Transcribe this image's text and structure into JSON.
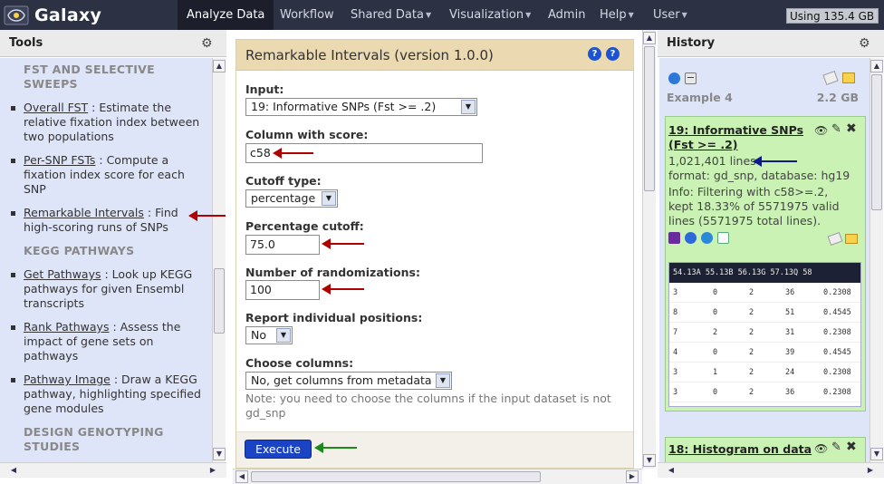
{
  "masthead": {
    "brand": "Galaxy",
    "tabs": [
      {
        "label": "Analyze Data",
        "active": true,
        "has_menu": false
      },
      {
        "label": "Workflow",
        "active": false,
        "has_menu": false
      },
      {
        "label": "Shared Data",
        "active": false,
        "has_menu": true
      },
      {
        "label": "Visualization",
        "active": false,
        "has_menu": true
      },
      {
        "label": "Admin",
        "active": false,
        "has_menu": false
      },
      {
        "label": "Help",
        "active": false,
        "has_menu": true
      },
      {
        "label": "User",
        "active": false,
        "has_menu": true
      }
    ],
    "usage": "Using 135.4 GB"
  },
  "tools": {
    "header": "Tools",
    "sections": [
      {
        "title": "FST AND SELECTIVE SWEEPS"
      },
      {
        "title": "KEGG PATHWAYS"
      },
      {
        "title": "DESIGN GENOTYPING STUDIES"
      }
    ],
    "items": [
      {
        "link": "Overall FST",
        "desc": " : Estimate the relative fixation index between two populations"
      },
      {
        "link": "Per-SNP FSTs",
        "desc": " : Compute a fixation index score for each SNP"
      },
      {
        "link": "Remarkable Intervals",
        "desc": " : Find high-scoring runs of SNPs"
      },
      {
        "link": "Get Pathways",
        "desc": " : Look up KEGG pathways for given Ensembl transcripts"
      },
      {
        "link": "Rank Pathways",
        "desc": " : Assess the impact of gene sets on pathways"
      },
      {
        "link": "Pathway Image",
        "desc": " : Draw a KEGG pathway, highlighting specified gene modules"
      }
    ]
  },
  "form": {
    "title": "Remarkable Intervals (version 1.0.0)",
    "input_label": "Input:",
    "input_value": "19: Informative SNPs (Fst >= .2)",
    "column_label": "Column with score:",
    "column_value": "c58",
    "cutoff_type_label": "Cutoff type:",
    "cutoff_type_value": "percentage",
    "pct_label": "Percentage cutoff:",
    "pct_value": "75.0",
    "rand_label": "Number of randomizations:",
    "rand_value": "100",
    "report_label": "Report individual positions:",
    "report_value": "No",
    "columns_label": "Choose columns:",
    "columns_value": "No, get columns from metadata",
    "note": "Note: you need to choose the columns if the input dataset is not gd_snp",
    "execute": "Execute"
  },
  "history": {
    "header": "History",
    "name": "Example 4",
    "size": "2.2 GB",
    "dataset19": {
      "title_line1": "19: Informative SNPs",
      "title_line2": "(Fst >= .2)",
      "lines": "1,021,401 lines",
      "format": "format: gd_snp, database: hg19",
      "info1": "Info: Filtering with c58>=.2,",
      "info2": "kept 18.33% of 5571975 valid",
      "info3": "lines (5571975 total lines).",
      "peek_header": "54.13A 55.13B 56.13G 57.13Q 58",
      "peek_rows": [
        [
          "3",
          "0",
          "2",
          "36",
          "0.2308"
        ],
        [
          "8",
          "0",
          "2",
          "51",
          "0.4545"
        ],
        [
          "7",
          "2",
          "2",
          "31",
          "0.2308"
        ],
        [
          "4",
          "0",
          "2",
          "39",
          "0.4545"
        ],
        [
          "3",
          "1",
          "2",
          "24",
          "0.2308"
        ],
        [
          "3",
          "0",
          "2",
          "36",
          "0.2308"
        ]
      ]
    },
    "dataset18": {
      "title": "18: Histogram on data"
    }
  },
  "colors": {
    "masthead": "#2c3143",
    "panel_bg": "#dfe5f9",
    "form_title_bg": "#ebd9b2",
    "ok_dataset": "#c9f2b4",
    "execute": "#1a44c4",
    "annotation_red": "#b00000",
    "annotation_blue": "#0c1a8a",
    "annotation_green": "#1b8a1b"
  }
}
